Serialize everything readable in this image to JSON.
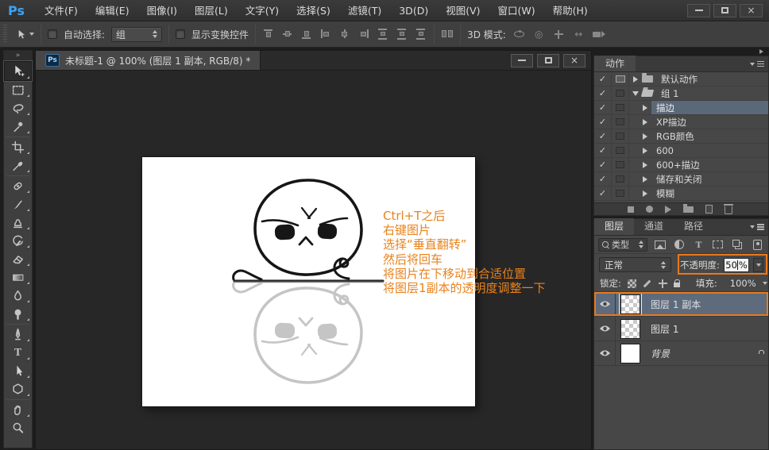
{
  "glyphs": {
    "check": "✓",
    "close": "×",
    "collapse": "»",
    "roll": "◎",
    "slide": "↔",
    "type_tool": "T"
  },
  "window": {
    "logo": "Ps"
  },
  "menu": {
    "items": [
      "文件(F)",
      "编辑(E)",
      "图像(I)",
      "图层(L)",
      "文字(Y)",
      "选择(S)",
      "滤镜(T)",
      "3D(D)",
      "视图(V)",
      "窗口(W)",
      "帮助(H)"
    ]
  },
  "options_bar": {
    "auto_select_label": "自动选择:",
    "auto_select_value": "组",
    "show_transform_label": "显示变换控件",
    "mode_3d_label": "3D 模式:"
  },
  "toolbar": {
    "selected_tool": "move",
    "tools": [
      "move",
      "rectangular-marquee",
      "lasso",
      "magic-wand",
      "crop",
      "eyedropper",
      "spot-healing-brush",
      "brush",
      "clone-stamp",
      "history-brush",
      "eraser",
      "gradient",
      "blur",
      "dodge",
      "pen",
      "type",
      "path-selection",
      "custom-shape",
      "hand",
      "zoom"
    ]
  },
  "document": {
    "tab_logo": "Ps",
    "tab_title": "未标题-1 @ 100% (图层 1 副本, RGB/8) *"
  },
  "canvas_annotation": {
    "color": "#E8821C",
    "lines": [
      "Ctrl+T之后",
      "右键图片",
      "选择“垂直翻转”",
      "然后将回车",
      "将图片在下移动到合适位置",
      "将图层1副本的透明度调整一下"
    ]
  },
  "actions_panel": {
    "tab": "动作",
    "rows": [
      {
        "label": "默认动作"
      },
      {
        "label": "组 1"
      },
      {
        "label": "描边"
      },
      {
        "label": "XP描边"
      },
      {
        "label": "RGB颜色"
      },
      {
        "label": "600"
      },
      {
        "label": "600+描边"
      },
      {
        "label": "储存和关闭"
      },
      {
        "label": "模糊"
      }
    ]
  },
  "layers_panel": {
    "tabs": [
      "图层",
      "通道",
      "路径"
    ],
    "filter_label": "类型",
    "blend_mode": "正常",
    "opacity_label": "不透明度:",
    "opacity_value": "50",
    "opacity_unit": "%",
    "lock_label": "锁定:",
    "fill_label": "填充:",
    "fill_value": "100%",
    "layers": [
      {
        "name": "图层 1 副本"
      },
      {
        "name": "图层 1"
      },
      {
        "name": "背景"
      }
    ]
  },
  "colors": {
    "accent_orange": "#E8791D",
    "annotation_orange": "#E8821C",
    "selection_blue_gray": "#5C6B7C",
    "ps_blue": "#31A8FF"
  }
}
